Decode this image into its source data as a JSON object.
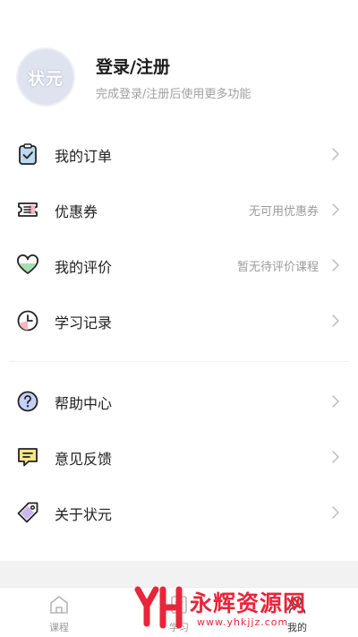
{
  "profile": {
    "avatar_text": "状元",
    "title": "登录/注册",
    "subtitle": "完成登录/注册后使用更多功能"
  },
  "menu": {
    "group1": [
      {
        "label": "我的订单",
        "value": "",
        "icon": "clipboard-check-icon"
      },
      {
        "label": "优惠券",
        "value": "无可用优惠券",
        "icon": "coupon-ticket-icon"
      },
      {
        "label": "我的评价",
        "value": "暂无待评价课程",
        "icon": "heart-icon"
      },
      {
        "label": "学习记录",
        "value": "",
        "icon": "clock-icon"
      }
    ],
    "group2": [
      {
        "label": "帮助中心",
        "value": "",
        "icon": "help-question-icon"
      },
      {
        "label": "意见反馈",
        "value": "",
        "icon": "feedback-message-icon"
      },
      {
        "label": "关于状元",
        "value": "",
        "icon": "tag-icon"
      }
    ]
  },
  "tabbar": {
    "tabs": [
      {
        "label": "课程",
        "icon": "home-icon"
      },
      {
        "label": "学习",
        "icon": "study-icon"
      },
      {
        "label": "我的",
        "icon": "profile-icon"
      }
    ]
  },
  "watermark": {
    "logo_text": "YH",
    "title": "永辉资源网",
    "url": "www.yhkjjz.com"
  },
  "colors": {
    "accent_red": "#e8253a",
    "icon_blue": "#a9c2ec",
    "icon_green": "#a9dfb3",
    "icon_pink": "#f5b6c2",
    "icon_yellow": "#f7e58a",
    "icon_purple": "#c9b8f0"
  }
}
